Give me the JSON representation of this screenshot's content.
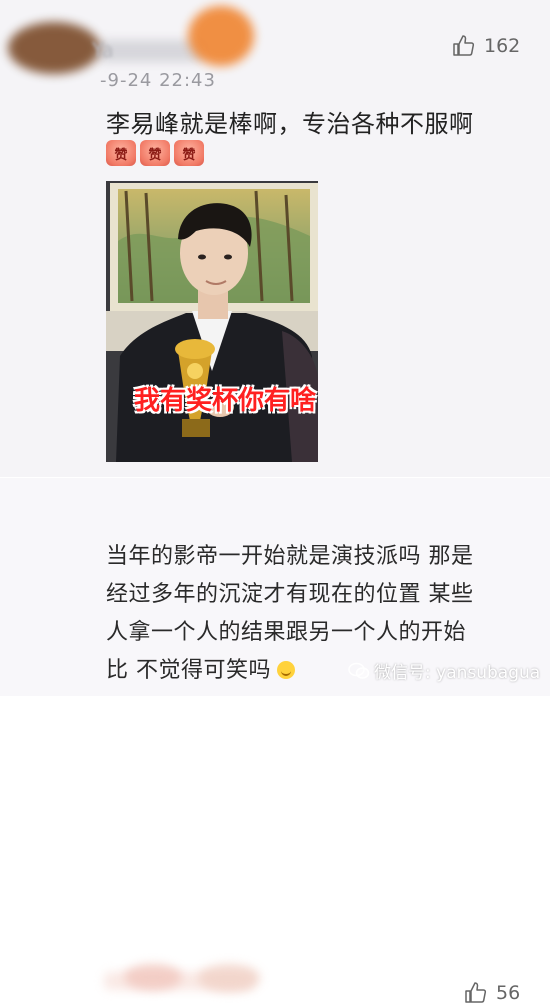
{
  "comments": [
    {
      "timestamp": "-9-24 22:43",
      "username": "Ya",
      "likes": "162",
      "text": "李易峰就是棒啊，专治各种不服啊",
      "emojis": [
        "赞",
        "赞",
        "赞"
      ],
      "image_caption": "我有奖杯你有啥"
    },
    {
      "likes": "56",
      "lines": [
        "当年的影帝一开始就是演技派吗 那是",
        "经过多年的沉淀才有现在的位置 某些",
        "人拿一个人的结果跟另一个人的开始",
        "比 不觉得可笑吗"
      ]
    }
  ],
  "watermark": "微信号: yansubagua",
  "colors": {
    "card_bg": "#f5f4f7",
    "text": "#222222",
    "meta": "#9a9aa0",
    "caption": "#ff2020"
  },
  "icons": [
    "thumbs-up-icon",
    "smile-emoji-icon",
    "wechat-icon"
  ]
}
